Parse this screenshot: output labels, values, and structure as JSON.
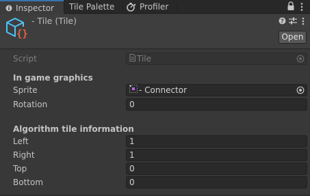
{
  "tabs": [
    {
      "label": "Inspector",
      "icon": "info-icon",
      "active": true
    },
    {
      "label": "Tile Palette",
      "icon": "",
      "active": false
    },
    {
      "label": "Profiler",
      "icon": "profiler-icon",
      "active": false
    }
  ],
  "header": {
    "title": "- Tile (Tile)",
    "open_label": "Open",
    "icon": "tile-script-icon"
  },
  "script_row": {
    "label": "Script",
    "value": "Tile"
  },
  "graphics": {
    "section_title": "In game graphics",
    "sprite_label": "Sprite",
    "sprite_value": "- Connector",
    "rotation_label": "Rotation",
    "rotation_value": "0"
  },
  "algorithm": {
    "section_title": "Algorithm tile information",
    "left_label": "Left",
    "left_value": "1",
    "right_label": "Right",
    "right_value": "1",
    "top_label": "Top",
    "top_value": "0",
    "bottom_label": "Bottom",
    "bottom_value": "0"
  },
  "colors": {
    "background": "#383838",
    "accent": "#3a72b0",
    "icon_cyan": "#4fc3f7",
    "icon_orange": "#e8643c"
  }
}
